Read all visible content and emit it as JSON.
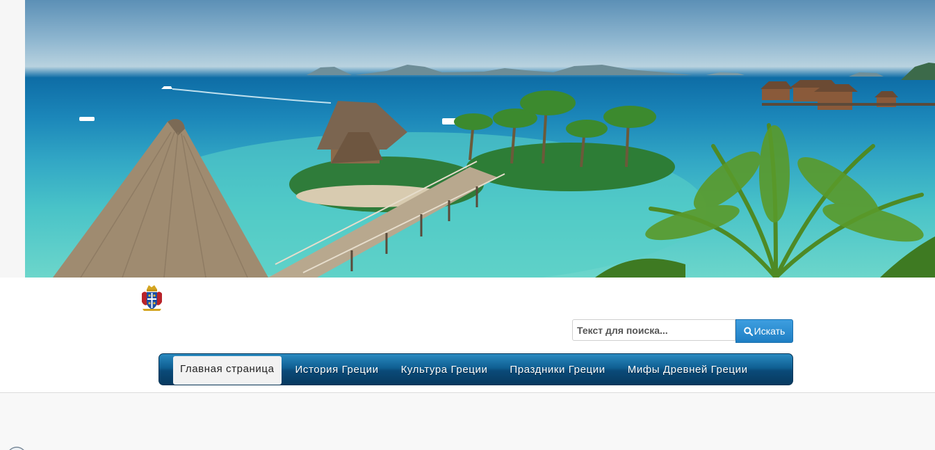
{
  "search": {
    "placeholder": "Текст для поиска...",
    "button_label": "Искать"
  },
  "nav": {
    "items": [
      {
        "label": "Главная страница",
        "active": true
      },
      {
        "label": "История Греции",
        "active": false
      },
      {
        "label": "Культура Греции",
        "active": false
      },
      {
        "label": "Праздники Греции",
        "active": false
      },
      {
        "label": "Мифы Древней Греции",
        "active": false
      }
    ]
  },
  "colors": {
    "nav_bar": "#0f5f92",
    "search_button": "#2a8fd4",
    "active_tab": "#f2f2f2"
  },
  "icons": {
    "search": "search-icon",
    "logo": "coat-of-arms-logo"
  }
}
